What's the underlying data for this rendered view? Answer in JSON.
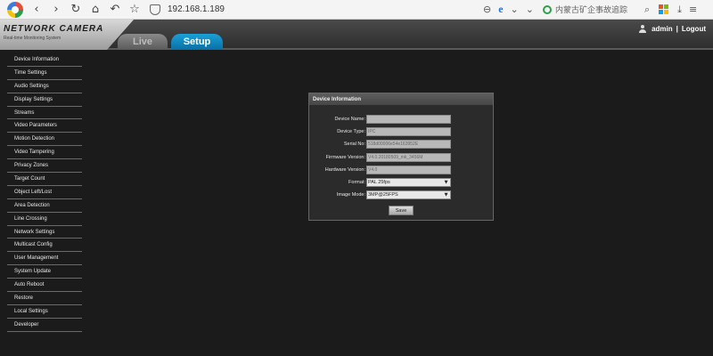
{
  "browser": {
    "address": "192.168.1.189",
    "search_placeholder": "内蒙古矿企事故追踪"
  },
  "header": {
    "brand": "NETWORK CAMERA",
    "brand_subtitle": "Real-time Monitoring System",
    "tabs": [
      {
        "label": "Live",
        "active": false
      },
      {
        "label": "Setup",
        "active": true
      }
    ],
    "username": "admin",
    "separator": "|",
    "logout_label": "Logout",
    "accent_color": "#1aa0d8"
  },
  "sidebar": {
    "items": [
      "Device Information",
      "Time Settings",
      "Audio Settings",
      "Display Settings",
      "Streams",
      "Video Parameters",
      "Motion Detection",
      "Video Tampering",
      "Privacy Zones",
      "Target Count",
      "Object Left/Lost",
      "Area Detection",
      "Line Crossing",
      "Network Settings",
      "Multicast Config",
      "User Management",
      "System Update",
      "Auto Reboot",
      "Restore",
      "Local Settings",
      "Developer"
    ]
  },
  "panel": {
    "title": "Device Information",
    "fields": {
      "device_name": {
        "label": "Device Name:",
        "value": ""
      },
      "device_type": {
        "label": "Device Type:",
        "value": "IPC"
      },
      "serial_no": {
        "label": "Serial No:",
        "value": "518d00006e54e163952E"
      },
      "firmware_version": {
        "label": "Firmware Version:",
        "value": "V4.0.20180509_mk_3456M"
      },
      "hardware_version": {
        "label": "Hardware Version:",
        "value": "V4.0"
      },
      "format": {
        "label": "Format:",
        "value": "PAL 25fps"
      },
      "image_mode": {
        "label": "Image Mode:",
        "value": "3MP@25FPS"
      }
    },
    "save_label": "Save"
  }
}
